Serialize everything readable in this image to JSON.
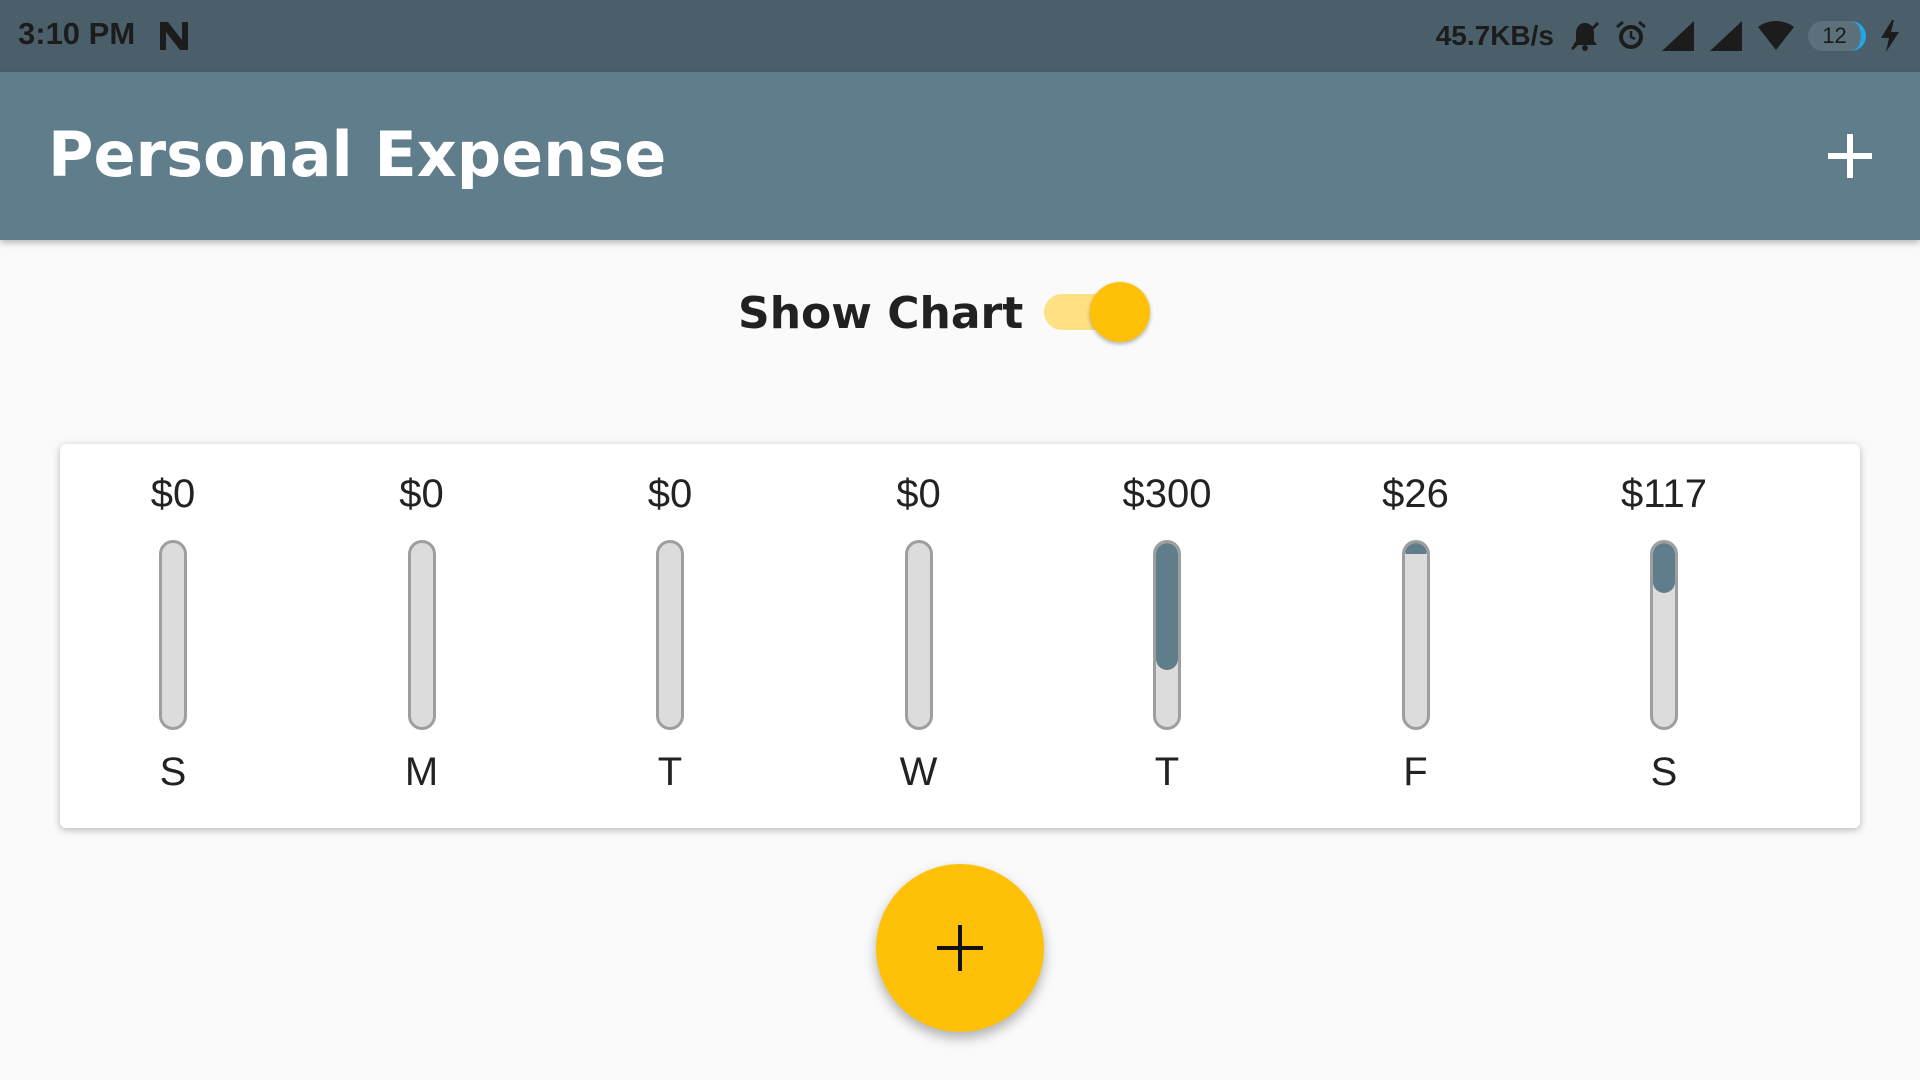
{
  "status_bar": {
    "time": "3:10 PM",
    "network_speed": "45.7KB/s",
    "battery_level": "12",
    "icons": [
      "notification-n-icon",
      "mute-bell-icon",
      "alarm-icon",
      "signal-icon",
      "signal-icon",
      "wifi-icon",
      "battery-icon",
      "charging-icon"
    ]
  },
  "app_bar": {
    "title": "Personal Expense",
    "add_icon": "plus-icon"
  },
  "toggle": {
    "label": "Show Chart",
    "on": true
  },
  "fab": {
    "icon": "plus-icon"
  },
  "colors": {
    "status_bar": "#4b5f6b",
    "primary": "#607d8b",
    "accent": "#ffc107",
    "accent_light": "#ffe082",
    "background": "#fafafa",
    "bar_track": "#dcdcdc"
  },
  "chart_data": {
    "type": "bar",
    "categories": [
      "S",
      "M",
      "T",
      "W",
      "T",
      "F",
      "S"
    ],
    "values": [
      0,
      0,
      0,
      0,
      300,
      26,
      117
    ],
    "value_labels": [
      "$0",
      "$0",
      "$0",
      "$0",
      "$300",
      "$26",
      "$117"
    ],
    "fill_fractions": [
      0,
      0,
      0,
      0,
      0.69,
      0.06,
      0.27
    ]
  }
}
